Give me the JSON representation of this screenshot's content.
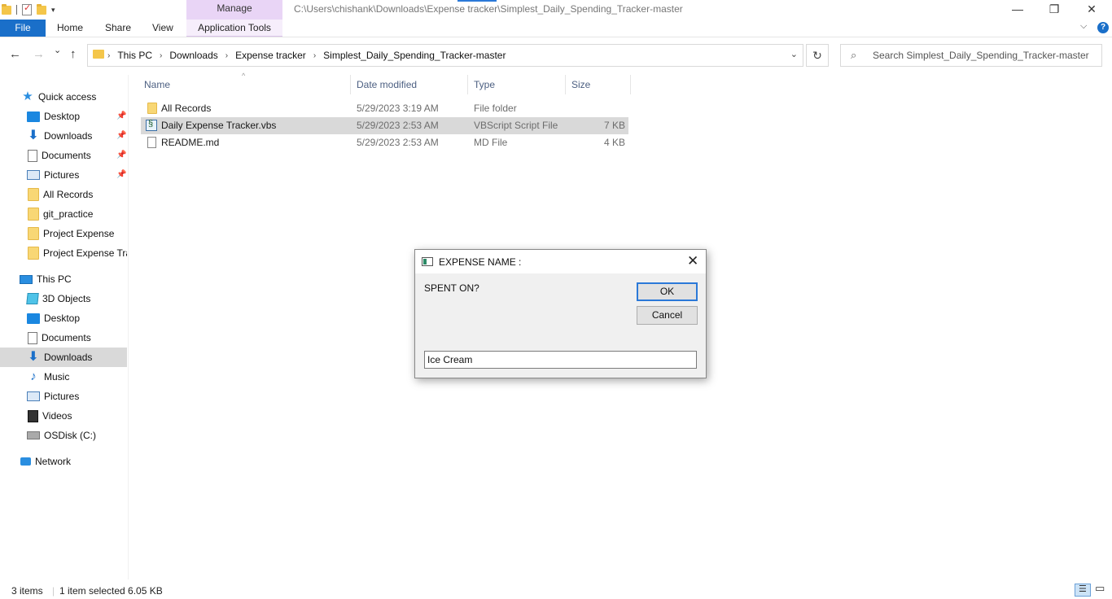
{
  "titlebar": {
    "contextual_tab": "Manage",
    "path": "C:\\Users\\chishank\\Downloads\\Expense tracker\\Simplest_Daily_Spending_Tracker-master",
    "minimize": "—",
    "restore": "❐",
    "close": "✕"
  },
  "ribbon": {
    "file": "File",
    "tabs": [
      "Home",
      "Share",
      "View"
    ],
    "app_tools": "Application Tools",
    "collapse": "⌵",
    "help": "?"
  },
  "address": {
    "back": "←",
    "forward": "→",
    "recent": "⌄",
    "up": "↑",
    "crumbs": [
      "This PC",
      "Downloads",
      "Expense tracker",
      "Simplest_Daily_Spending_Tracker-master"
    ],
    "chevron": "›",
    "dropdown": "⌄",
    "refresh": "↻",
    "search_placeholder": "Search Simplest_Daily_Spending_Tracker-master"
  },
  "nav": {
    "pin": "📌",
    "quick_access": "Quick access",
    "quick_items": [
      {
        "label": "Desktop",
        "pinned": true
      },
      {
        "label": "Downloads",
        "pinned": true
      },
      {
        "label": "Documents",
        "pinned": true
      },
      {
        "label": "Pictures",
        "pinned": true
      },
      {
        "label": "All Records",
        "pinned": false
      },
      {
        "label": "git_practice",
        "pinned": false
      },
      {
        "label": "Project Expense",
        "pinned": false
      },
      {
        "label": "Project Expense Tra",
        "pinned": false
      }
    ],
    "this_pc": "This PC",
    "pc_items": [
      "3D Objects",
      "Desktop",
      "Documents",
      "Downloads",
      "Music",
      "Pictures",
      "Videos",
      "OSDisk (C:)"
    ],
    "network": "Network",
    "selected": "Downloads"
  },
  "filelist": {
    "columns": [
      "Name",
      "Date modified",
      "Type",
      "Size"
    ],
    "rows": [
      {
        "name": "All Records",
        "date": "5/29/2023 3:19 AM",
        "type": "File folder",
        "size": "",
        "icon": "folder-icon",
        "selected": false
      },
      {
        "name": "Daily Expense Tracker.vbs",
        "date": "5/29/2023 2:53 AM",
        "type": "VBScript Script File",
        "size": "7 KB",
        "icon": "vbscript-file-icon",
        "selected": true
      },
      {
        "name": "README.md",
        "date": "5/29/2023 2:53 AM",
        "type": "MD File",
        "size": "4 KB",
        "icon": "document-file-icon",
        "selected": false
      }
    ]
  },
  "dialog": {
    "title": "EXPENSE NAME :",
    "close": "✕",
    "prompt": "SPENT ON?",
    "ok": "OK",
    "cancel": "Cancel",
    "input_value": "Ice Cream"
  },
  "status": {
    "items": "3 items",
    "selection": "1 item selected  6.05 KB"
  }
}
